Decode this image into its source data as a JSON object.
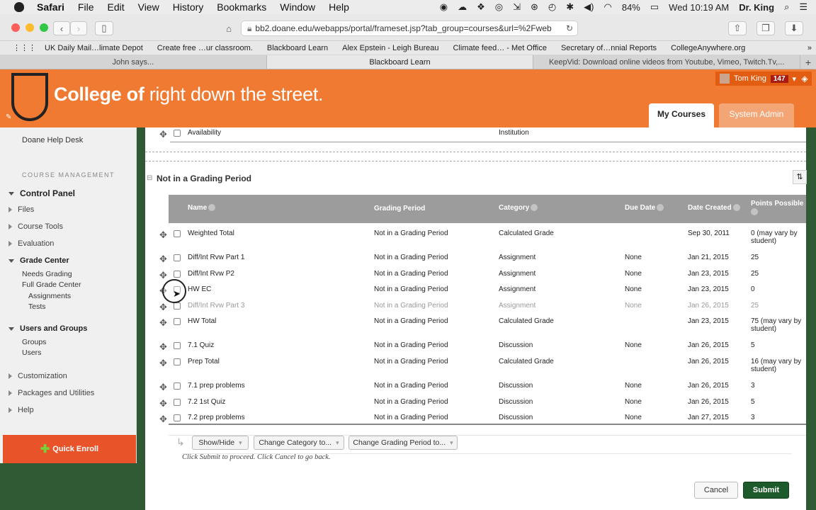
{
  "menubar": {
    "app": "Safari",
    "items": [
      "File",
      "Edit",
      "View",
      "History",
      "Bookmarks",
      "Window",
      "Help"
    ],
    "battery": "84%",
    "time": "Wed 10:19 AM",
    "user": "Dr. King"
  },
  "browser": {
    "url": "bb2.doane.edu/webapps/portal/frameset.jsp?tab_group=courses&url=%2Fweb",
    "bookmarks": [
      "UK Daily Mail…limate Depot",
      "Create free …ur classroom.",
      "Blackboard Learn",
      "Alex Epstein - Leigh Bureau",
      "Climate feed… - Met Office",
      "Secretary of…nnial Reports",
      "CollegeAnywhere.org"
    ],
    "tabs": [
      "John says...",
      "Blackboard Learn",
      "KeepVid: Download online videos from Youtube, Vimeo, Twitch.Tv,..."
    ]
  },
  "header": {
    "logo_bold": "College of",
    "logo_rest": " right down the street.",
    "user": "Tom King",
    "notifications": "147",
    "tab_courses": "My Courses",
    "tab_admin": "System Admin"
  },
  "nav": {
    "help": "Doane Help Desk",
    "section": "COURSE MANAGEMENT",
    "control_panel": "Control Panel",
    "files": "Files",
    "course_tools": "Course Tools",
    "evaluation": "Evaluation",
    "grade_center": "Grade Center",
    "needs_grading": "Needs Grading",
    "full_grade_center": "Full Grade Center",
    "assignments": "Assignments",
    "tests": "Tests",
    "users_groups": "Users and Groups",
    "groups": "Groups",
    "users": "Users",
    "customization": "Customization",
    "packages": "Packages and Utilities",
    "help_item": "Help",
    "quick_enroll": "Quick Enroll"
  },
  "top_row": {
    "name": "Availability",
    "category": "Institution"
  },
  "section_title": "Not in a Grading Period",
  "columns": {
    "name": "Name",
    "grading_period": "Grading Period",
    "category": "Category",
    "due_date": "Due Date",
    "date_created": "Date Created",
    "points": "Points Possible"
  },
  "rows": [
    {
      "name": "Weighted Total",
      "period": "Not in a Grading Period",
      "category": "Calculated Grade",
      "due": "",
      "created": "Sep 30, 2011",
      "points": "0 (may vary by",
      "points2": "student)"
    },
    {
      "name": "Diff/Int Rvw Part 1",
      "period": "Not in a Grading Period",
      "category": "Assignment",
      "due": "None",
      "created": "Jan 21, 2015",
      "points": "25",
      "points2": ""
    },
    {
      "name": "Diff/Int Rvw P2",
      "period": "Not in a Grading Period",
      "category": "Assignment",
      "due": "None",
      "created": "Jan 23, 2015",
      "points": "25",
      "points2": ""
    },
    {
      "name": "HW EC",
      "period": "Not in a Grading Period",
      "category": "Assignment",
      "due": "None",
      "created": "Jan 23, 2015",
      "points": "0",
      "points2": ""
    },
    {
      "name": "Diff/Int Rvw Part 3",
      "period": "Not in a Grading Period",
      "category": "Assignment",
      "due": "None",
      "created": "Jan 26, 2015",
      "points": "25",
      "points2": ""
    },
    {
      "name": "HW Total",
      "period": "Not in a Grading Period",
      "category": "Calculated Grade",
      "due": "",
      "created": "Jan 23, 2015",
      "points": "75 (may vary by",
      "points2": "student)"
    },
    {
      "name": "7.1 Quiz",
      "period": "Not in a Grading Period",
      "category": "Discussion",
      "due": "None",
      "created": "Jan 26, 2015",
      "points": "5",
      "points2": ""
    },
    {
      "name": "Prep Total",
      "period": "Not in a Grading Period",
      "category": "Calculated Grade",
      "due": "",
      "created": "Jan 26, 2015",
      "points": "16 (may vary by",
      "points2": "student)"
    },
    {
      "name": "7.1 prep problems",
      "period": "Not in a Grading Period",
      "category": "Discussion",
      "due": "None",
      "created": "Jan 26, 2015",
      "points": "3",
      "points2": ""
    },
    {
      "name": "7.2 1st Quiz",
      "period": "Not in a Grading Period",
      "category": "Discussion",
      "due": "None",
      "created": "Jan 26, 2015",
      "points": "5",
      "points2": ""
    },
    {
      "name": "7.2 prep problems",
      "period": "Not in a Grading Period",
      "category": "Discussion",
      "due": "None",
      "created": "Jan 27, 2015",
      "points": "3",
      "points2": ""
    }
  ],
  "actions": {
    "show_hide": "Show/Hide",
    "change_category": "Change Category to...",
    "change_period": "Change Grading Period to...",
    "instructions": "Click Submit to proceed. Click Cancel to go back.",
    "cancel": "Cancel",
    "submit": "Submit"
  }
}
